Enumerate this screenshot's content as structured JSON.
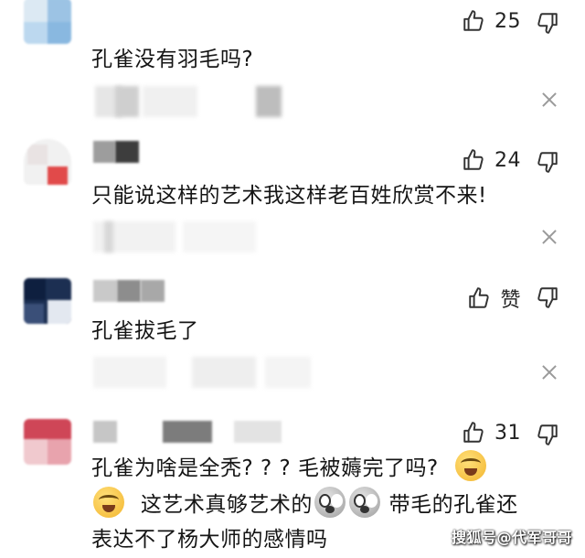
{
  "comments": [
    {
      "likes": "25",
      "text": "孔雀没有羽毛吗?"
    },
    {
      "likes": "24",
      "text": "只能说这样的艺术我这样老百姓欣赏不来!"
    },
    {
      "likes": "赞",
      "text": "孔雀拔毛了"
    },
    {
      "likes": "31",
      "line1": "孔雀为啥是全秃? ? ? 毛被薅完了吗?",
      "line2": "这艺术真够艺术的",
      "line2_tail": "带毛的孔雀还",
      "line3": "表达不了杨大师的感情吗"
    }
  ],
  "icons": {
    "like": "thumbs-up-icon",
    "dislike": "thumbs-down-icon",
    "close": "close-icon",
    "emoji_cry": "crying-laughing-emoji",
    "emoji_shock": "shocked-face-emoji"
  },
  "watermark": "搜狐号@代军哥哥",
  "colors": {
    "text": "#151515",
    "icon": "#333333",
    "close": "#9a9a9a"
  }
}
